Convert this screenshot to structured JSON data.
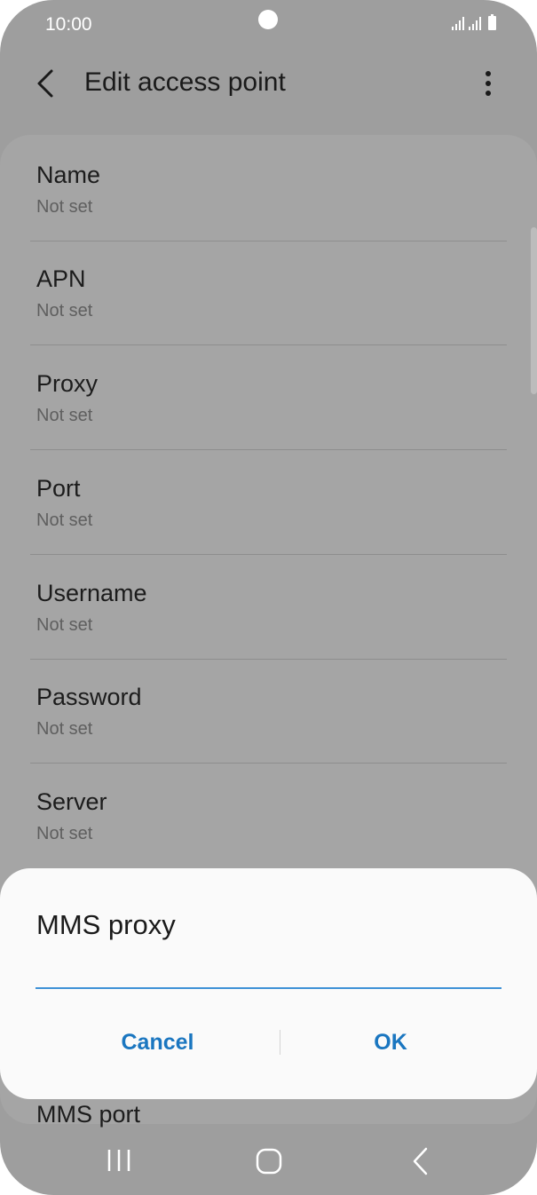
{
  "status_bar": {
    "time": "10:00",
    "icons": [
      "signal-sim1-icon",
      "signal-sim2-icon",
      "battery-icon"
    ]
  },
  "app_bar": {
    "back_icon": "back-arrow-icon",
    "title": "Edit access point",
    "more_icon": "more-vert-icon"
  },
  "settings": [
    {
      "label": "Name",
      "value": "Not set"
    },
    {
      "label": "APN",
      "value": "Not set"
    },
    {
      "label": "Proxy",
      "value": "Not set"
    },
    {
      "label": "Port",
      "value": "Not set"
    },
    {
      "label": "Username",
      "value": "Not set"
    },
    {
      "label": "Password",
      "value": "Not set"
    },
    {
      "label": "Server",
      "value": "Not set"
    }
  ],
  "partial_setting": {
    "label": "MMS port"
  },
  "dialog": {
    "title": "MMS proxy",
    "input_value": "",
    "cancel_label": "Cancel",
    "ok_label": "OK"
  },
  "nav_bar": {
    "icons": [
      "recents-icon",
      "home-icon",
      "back-icon"
    ]
  },
  "colors": {
    "accent": "#1a76c0",
    "input_underline": "#3e91d6",
    "scrim_background": "#9e9e9e",
    "dialog_background": "#fafafa"
  }
}
